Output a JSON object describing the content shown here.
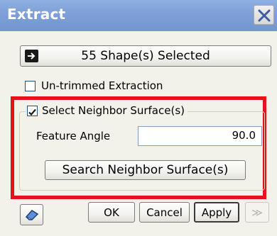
{
  "window": {
    "title": "Extract"
  },
  "selection": {
    "label": "55 Shape(s) Selected"
  },
  "untrimmed": {
    "label": "Un-trimmed Extraction",
    "checked": false
  },
  "neighbor_group": {
    "label": "Select Neighbor Surface(s)",
    "checked": true,
    "feature_angle_label": "Feature Angle",
    "feature_angle_value": "90.0",
    "search_button": "Search Neighbor Surface(s)"
  },
  "footer": {
    "ok": "OK",
    "cancel": "Cancel",
    "apply": "Apply",
    "more": "≫"
  },
  "colors": {
    "highlight": "#e5121b",
    "titlebar": "#7e9fd7"
  }
}
